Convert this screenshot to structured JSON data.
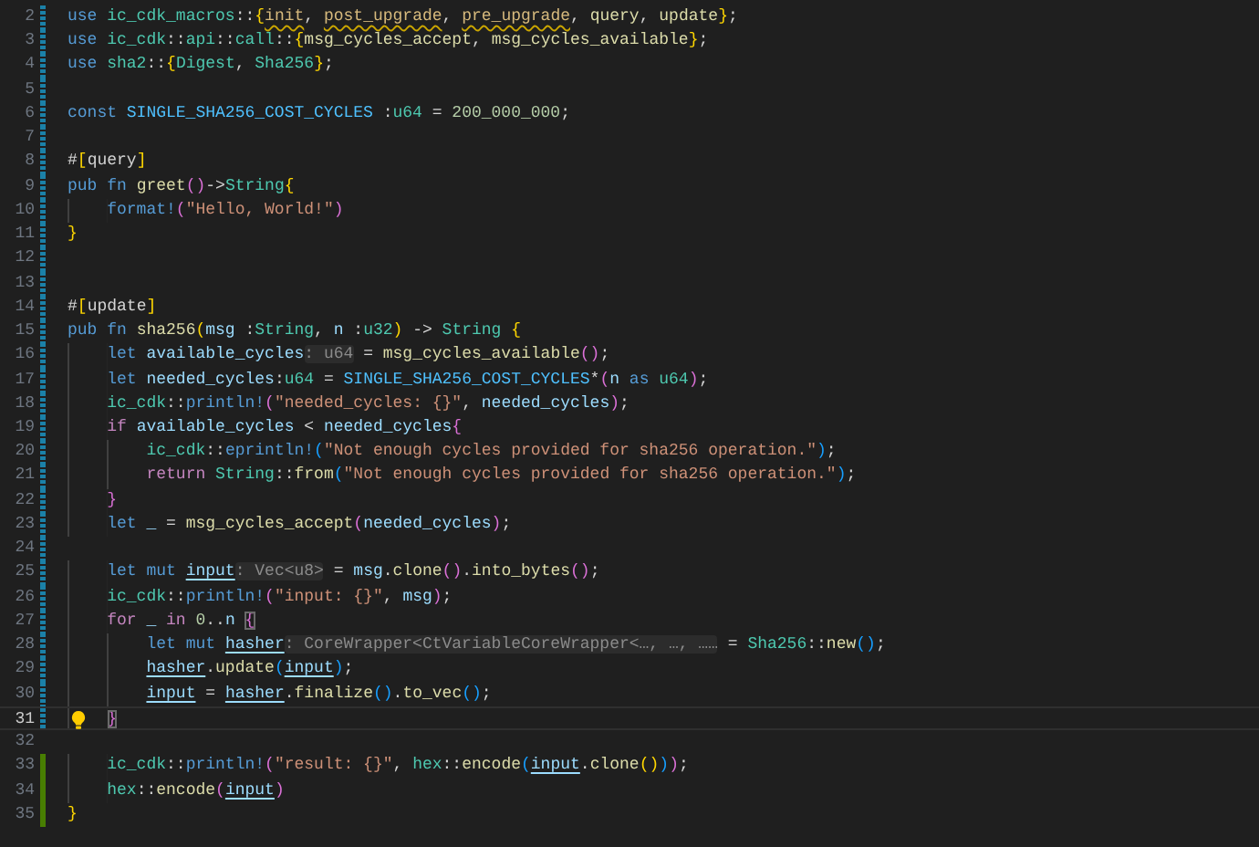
{
  "editor": {
    "lines": [
      {
        "number": "2",
        "modified": true,
        "added": false,
        "tokens": [
          {
            "text": "use ",
            "kind": "kw"
          },
          {
            "text": "ic_cdk_macros",
            "kind": "ns"
          },
          {
            "text": "::",
            "kind": "p"
          },
          {
            "text": "{",
            "kind": "b1"
          },
          {
            "text": "init",
            "kind": "warn"
          },
          {
            "text": ", ",
            "kind": "p"
          },
          {
            "text": "post_upgrade",
            "kind": "warn"
          },
          {
            "text": ", ",
            "kind": "p"
          },
          {
            "text": "pre_upgrade",
            "kind": "warn"
          },
          {
            "text": ", ",
            "kind": "p"
          },
          {
            "text": "query",
            "kind": "fn"
          },
          {
            "text": ", ",
            "kind": "p"
          },
          {
            "text": "update",
            "kind": "fn"
          },
          {
            "text": "}",
            "kind": "b1"
          },
          {
            "text": ";",
            "kind": "p"
          }
        ]
      },
      {
        "number": "3",
        "modified": true,
        "added": false,
        "tokens": [
          {
            "text": "use ",
            "kind": "kw"
          },
          {
            "text": "ic_cdk",
            "kind": "ns"
          },
          {
            "text": "::",
            "kind": "p"
          },
          {
            "text": "api",
            "kind": "ns"
          },
          {
            "text": "::",
            "kind": "p"
          },
          {
            "text": "call",
            "kind": "ns"
          },
          {
            "text": "::",
            "kind": "p"
          },
          {
            "text": "{",
            "kind": "b1"
          },
          {
            "text": "msg_cycles_accept",
            "kind": "fn"
          },
          {
            "text": ", ",
            "kind": "p"
          },
          {
            "text": "msg_cycles_available",
            "kind": "fn"
          },
          {
            "text": "}",
            "kind": "b1"
          },
          {
            "text": ";",
            "kind": "p"
          }
        ]
      },
      {
        "number": "4",
        "modified": true,
        "added": false,
        "tokens": [
          {
            "text": "use ",
            "kind": "kw"
          },
          {
            "text": "sha2",
            "kind": "ns"
          },
          {
            "text": "::",
            "kind": "p"
          },
          {
            "text": "{",
            "kind": "b1"
          },
          {
            "text": "Digest",
            "kind": "ty"
          },
          {
            "text": ", ",
            "kind": "p"
          },
          {
            "text": "Sha256",
            "kind": "ty"
          },
          {
            "text": "}",
            "kind": "b1"
          },
          {
            "text": ";",
            "kind": "p"
          }
        ]
      },
      {
        "number": "5",
        "modified": true,
        "added": false
      },
      {
        "number": "6",
        "modified": true,
        "added": false,
        "tokens": [
          {
            "text": "const ",
            "kind": "kw"
          },
          {
            "text": "SINGLE_SHA256_COST_CYCLES",
            "kind": "const"
          },
          {
            "text": " :",
            "kind": "p"
          },
          {
            "text": "u64",
            "kind": "ty"
          },
          {
            "text": " = ",
            "kind": "p"
          },
          {
            "text": "200_000_000",
            "kind": "num"
          },
          {
            "text": ";",
            "kind": "p"
          }
        ]
      },
      {
        "number": "7",
        "modified": true,
        "added": false
      },
      {
        "number": "8",
        "modified": true,
        "added": false,
        "tokens": [
          {
            "text": "#",
            "kind": "p"
          },
          {
            "text": "[",
            "kind": "b1"
          },
          {
            "text": "query",
            "kind": "p"
          },
          {
            "text": "]",
            "kind": "b1"
          }
        ]
      },
      {
        "number": "9",
        "modified": true,
        "added": false,
        "tokens": [
          {
            "text": "pub fn ",
            "kind": "kw"
          },
          {
            "text": "greet",
            "kind": "fn"
          },
          {
            "text": "()",
            "kind": "b2"
          },
          {
            "text": "->",
            "kind": "p"
          },
          {
            "text": "String",
            "kind": "ty"
          },
          {
            "text": "{",
            "kind": "b1"
          }
        ]
      },
      {
        "number": "10",
        "modified": true,
        "added": false,
        "tokens": [
          {
            "text": "    format!",
            "kind": "mac"
          },
          {
            "text": "(",
            "kind": "b2"
          },
          {
            "text": "\"Hello, World!\"",
            "kind": "str"
          },
          {
            "text": ")",
            "kind": "b2"
          }
        ]
      },
      {
        "number": "11",
        "modified": true,
        "added": false,
        "tokens": [
          {
            "text": "}",
            "kind": "b1"
          }
        ]
      },
      {
        "number": "12",
        "modified": true,
        "added": false
      },
      {
        "number": "13",
        "modified": true,
        "added": false
      },
      {
        "number": "14",
        "modified": true,
        "added": false,
        "tokens": [
          {
            "text": "#",
            "kind": "p"
          },
          {
            "text": "[",
            "kind": "b1"
          },
          {
            "text": "update",
            "kind": "p"
          },
          {
            "text": "]",
            "kind": "b1"
          }
        ]
      },
      {
        "number": "15",
        "modified": true,
        "added": false,
        "tokens": [
          {
            "text": "pub fn ",
            "kind": "kw"
          },
          {
            "text": "sha256",
            "kind": "fn"
          },
          {
            "text": "(",
            "kind": "b1"
          },
          {
            "text": "msg",
            "kind": "var"
          },
          {
            "text": " :",
            "kind": "p"
          },
          {
            "text": "String",
            "kind": "ty"
          },
          {
            "text": ", ",
            "kind": "p"
          },
          {
            "text": "n",
            "kind": "var"
          },
          {
            "text": " :",
            "kind": "p"
          },
          {
            "text": "u32",
            "kind": "ty"
          },
          {
            "text": ")",
            "kind": "b1"
          },
          {
            "text": " -> ",
            "kind": "p"
          },
          {
            "text": "String",
            "kind": "ty"
          },
          {
            "text": " {",
            "kind": "b1"
          }
        ]
      },
      {
        "number": "16",
        "modified": true,
        "added": false,
        "tokens": [
          {
            "text": "    let ",
            "kind": "kw"
          },
          {
            "text": "available_cycles",
            "kind": "var"
          },
          {
            "text": ": u64",
            "kind": "hint"
          },
          {
            "text": " = ",
            "kind": "p"
          },
          {
            "text": "msg_cycles_available",
            "kind": "fn"
          },
          {
            "text": "()",
            "kind": "b2"
          },
          {
            "text": ";",
            "kind": "p"
          }
        ]
      },
      {
        "number": "17",
        "modified": true,
        "added": false,
        "tokens": [
          {
            "text": "    let ",
            "kind": "kw"
          },
          {
            "text": "needed_cycles",
            "kind": "var"
          },
          {
            "text": ":",
            "kind": "p"
          },
          {
            "text": "u64",
            "kind": "ty"
          },
          {
            "text": " = ",
            "kind": "p"
          },
          {
            "text": "SINGLE_SHA256_COST_CYCLES",
            "kind": "const"
          },
          {
            "text": "*",
            "kind": "p"
          },
          {
            "text": "(",
            "kind": "b2"
          },
          {
            "text": "n",
            "kind": "var"
          },
          {
            "text": " as ",
            "kind": "kw"
          },
          {
            "text": "u64",
            "kind": "ty"
          },
          {
            "text": ")",
            "kind": "b2"
          },
          {
            "text": ";",
            "kind": "p"
          }
        ]
      },
      {
        "number": "18",
        "modified": true,
        "added": false,
        "tokens": [
          {
            "text": "    ic_cdk",
            "kind": "ns"
          },
          {
            "text": "::",
            "kind": "p"
          },
          {
            "text": "println!",
            "kind": "mac"
          },
          {
            "text": "(",
            "kind": "b2"
          },
          {
            "text": "\"needed_cycles: {}\"",
            "kind": "str"
          },
          {
            "text": ", ",
            "kind": "p"
          },
          {
            "text": "needed_cycles",
            "kind": "var"
          },
          {
            "text": ")",
            "kind": "b2"
          },
          {
            "text": ";",
            "kind": "p"
          }
        ]
      },
      {
        "number": "19",
        "modified": true,
        "added": false,
        "tokens": [
          {
            "text": "    if ",
            "kind": "ctl"
          },
          {
            "text": "available_cycles",
            "kind": "var"
          },
          {
            "text": " < ",
            "kind": "p"
          },
          {
            "text": "needed_cycles",
            "kind": "var"
          },
          {
            "text": "{",
            "kind": "b2"
          }
        ]
      },
      {
        "number": "20",
        "modified": true,
        "added": false,
        "tokens": [
          {
            "text": "        ic_cdk",
            "kind": "ns"
          },
          {
            "text": "::",
            "kind": "p"
          },
          {
            "text": "eprintln!",
            "kind": "mac"
          },
          {
            "text": "(",
            "kind": "b3"
          },
          {
            "text": "\"Not enough cycles provided for sha256 operation.\"",
            "kind": "str"
          },
          {
            "text": ")",
            "kind": "b3"
          },
          {
            "text": ";",
            "kind": "p"
          }
        ]
      },
      {
        "number": "21",
        "modified": true,
        "added": false,
        "tokens": [
          {
            "text": "        return ",
            "kind": "ctl"
          },
          {
            "text": "String",
            "kind": "ty"
          },
          {
            "text": "::",
            "kind": "p"
          },
          {
            "text": "from",
            "kind": "fn"
          },
          {
            "text": "(",
            "kind": "b3"
          },
          {
            "text": "\"Not enough cycles provided for sha256 operation.\"",
            "kind": "str"
          },
          {
            "text": ")",
            "kind": "b3"
          },
          {
            "text": ";",
            "kind": "p"
          }
        ]
      },
      {
        "number": "22",
        "modified": true,
        "added": false,
        "tokens": [
          {
            "text": "    }",
            "kind": "b2"
          }
        ]
      },
      {
        "number": "23",
        "modified": true,
        "added": false,
        "tokens": [
          {
            "text": "    let ",
            "kind": "kw"
          },
          {
            "text": "_",
            "kind": "var"
          },
          {
            "text": " = ",
            "kind": "p"
          },
          {
            "text": "msg_cycles_accept",
            "kind": "fn"
          },
          {
            "text": "(",
            "kind": "b2"
          },
          {
            "text": "needed_cycles",
            "kind": "var"
          },
          {
            "text": ")",
            "kind": "b2"
          },
          {
            "text": ";",
            "kind": "p"
          }
        ]
      },
      {
        "number": "24",
        "modified": true,
        "added": false
      },
      {
        "number": "25",
        "modified": true,
        "added": false,
        "tokens": [
          {
            "text": "    let mut ",
            "kind": "kw"
          },
          {
            "text": "input",
            "kind": "mutvar"
          },
          {
            "text": ": Vec<u8>",
            "kind": "hint"
          },
          {
            "text": " = ",
            "kind": "p"
          },
          {
            "text": "msg",
            "kind": "var"
          },
          {
            "text": ".",
            "kind": "p"
          },
          {
            "text": "clone",
            "kind": "fn"
          },
          {
            "text": "()",
            "kind": "b2"
          },
          {
            "text": ".",
            "kind": "p"
          },
          {
            "text": "into_bytes",
            "kind": "fn"
          },
          {
            "text": "()",
            "kind": "b2"
          },
          {
            "text": ";",
            "kind": "p"
          }
        ]
      },
      {
        "number": "26",
        "modified": true,
        "added": false,
        "tokens": [
          {
            "text": "    ic_cdk",
            "kind": "ns"
          },
          {
            "text": "::",
            "kind": "p"
          },
          {
            "text": "println!",
            "kind": "mac"
          },
          {
            "text": "(",
            "kind": "b2"
          },
          {
            "text": "\"input: {}\"",
            "kind": "str"
          },
          {
            "text": ", ",
            "kind": "p"
          },
          {
            "text": "msg",
            "kind": "var"
          },
          {
            "text": ")",
            "kind": "b2"
          },
          {
            "text": ";",
            "kind": "p"
          }
        ]
      },
      {
        "number": "27",
        "modified": true,
        "added": false,
        "tokens": [
          {
            "text": "    for ",
            "kind": "ctl"
          },
          {
            "text": "_",
            "kind": "var"
          },
          {
            "text": " in ",
            "kind": "ctl"
          },
          {
            "text": "0",
            "kind": "num"
          },
          {
            "text": "..",
            "kind": "p"
          },
          {
            "text": "n",
            "kind": "var"
          },
          {
            "text": " {",
            "kind": "match"
          }
        ]
      },
      {
        "number": "28",
        "modified": true,
        "added": false,
        "tokens": [
          {
            "text": "        let mut ",
            "kind": "kw"
          },
          {
            "text": "hasher",
            "kind": "mutvar"
          },
          {
            "text": ": CoreWrapper<CtVariableCoreWrapper<…, …, ……",
            "kind": "hint"
          },
          {
            "text": " = ",
            "kind": "p"
          },
          {
            "text": "Sha256",
            "kind": "ty"
          },
          {
            "text": "::",
            "kind": "p"
          },
          {
            "text": "new",
            "kind": "fn"
          },
          {
            "text": "()",
            "kind": "b3"
          },
          {
            "text": ";",
            "kind": "p"
          }
        ]
      },
      {
        "number": "29",
        "modified": true,
        "added": false,
        "tokens": [
          {
            "text": "        hasher",
            "kind": "mutvar"
          },
          {
            "text": ".",
            "kind": "p"
          },
          {
            "text": "update",
            "kind": "fn"
          },
          {
            "text": "(",
            "kind": "b3"
          },
          {
            "text": "input",
            "kind": "mutvar"
          },
          {
            "text": ")",
            "kind": "b3"
          },
          {
            "text": ";",
            "kind": "p"
          }
        ]
      },
      {
        "number": "30",
        "modified": true,
        "added": false,
        "tokens": [
          {
            "text": "        input",
            "kind": "mutvar"
          },
          {
            "text": " = ",
            "kind": "p"
          },
          {
            "text": "hasher",
            "kind": "mutvar"
          },
          {
            "text": ".",
            "kind": "p"
          },
          {
            "text": "finalize",
            "kind": "fn"
          },
          {
            "text": "()",
            "kind": "b3"
          },
          {
            "text": ".",
            "kind": "p"
          },
          {
            "text": "to_vec",
            "kind": "fn"
          },
          {
            "text": "()",
            "kind": "b3"
          },
          {
            "text": ";",
            "kind": "p"
          }
        ]
      },
      {
        "number": "31",
        "modified": true,
        "added": false,
        "current": true,
        "lightbulb": true,
        "tokens": [
          {
            "text": "    }",
            "kind": "match"
          }
        ]
      },
      {
        "number": "32",
        "modified": false,
        "added": false
      },
      {
        "number": "33",
        "modified": false,
        "added": true,
        "tokens": [
          {
            "text": "    ic_cdk",
            "kind": "ns"
          },
          {
            "text": "::",
            "kind": "p"
          },
          {
            "text": "println!",
            "kind": "mac"
          },
          {
            "text": "(",
            "kind": "b2"
          },
          {
            "text": "\"result: {}\"",
            "kind": "str"
          },
          {
            "text": ", ",
            "kind": "p"
          },
          {
            "text": "hex",
            "kind": "ns"
          },
          {
            "text": "::",
            "kind": "p"
          },
          {
            "text": "encode",
            "kind": "fn"
          },
          {
            "text": "(",
            "kind": "b3"
          },
          {
            "text": "input",
            "kind": "mutvar"
          },
          {
            "text": ".",
            "kind": "p"
          },
          {
            "text": "clone",
            "kind": "fn"
          },
          {
            "text": "()",
            "kind": "b1"
          },
          {
            "text": ")",
            "kind": "b3"
          },
          {
            "text": ")",
            "kind": "b2"
          },
          {
            "text": ";",
            "kind": "p"
          }
        ]
      },
      {
        "number": "34",
        "modified": false,
        "added": true,
        "tokens": [
          {
            "text": "    hex",
            "kind": "ns"
          },
          {
            "text": "::",
            "kind": "p"
          },
          {
            "text": "encode",
            "kind": "fn"
          },
          {
            "text": "(",
            "kind": "b2"
          },
          {
            "text": "input",
            "kind": "mutvar"
          },
          {
            "text": ")",
            "kind": "b2"
          }
        ]
      },
      {
        "number": "35",
        "modified": false,
        "added": true,
        "tokens": [
          {
            "text": "}",
            "kind": "b1"
          }
        ]
      }
    ]
  }
}
